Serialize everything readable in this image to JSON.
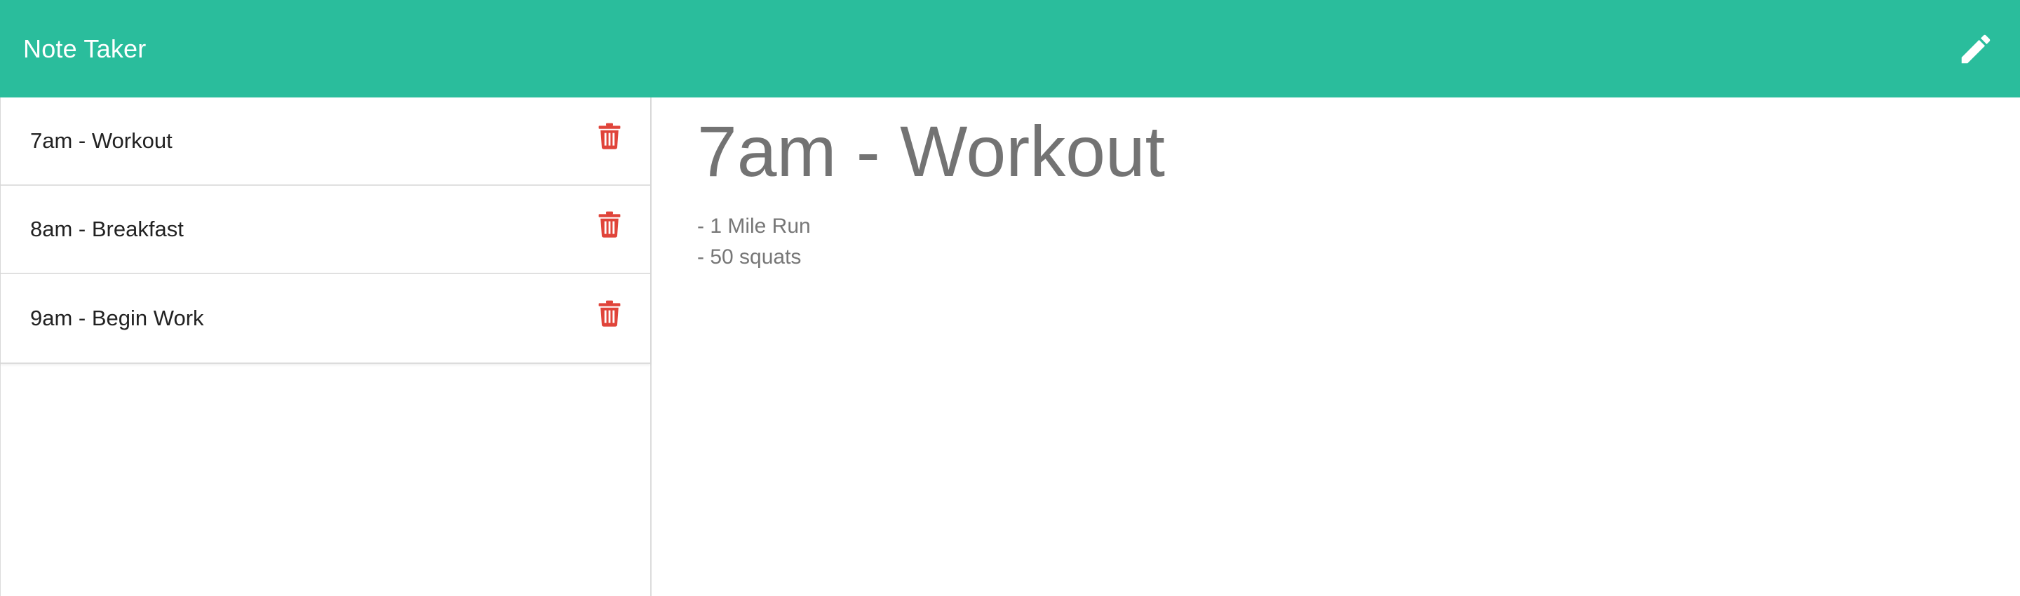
{
  "app": {
    "title": "Note Taker",
    "accent_color": "#2abd9c",
    "delete_color": "#e0443a"
  },
  "header": {
    "new_note_icon": "pencil-icon"
  },
  "sidebar": {
    "notes": [
      {
        "title": "7am - Workout",
        "delete_icon": "trash-icon"
      },
      {
        "title": "8am - Breakfast",
        "delete_icon": "trash-icon"
      },
      {
        "title": "9am - Begin Work",
        "delete_icon": "trash-icon"
      }
    ]
  },
  "main": {
    "active_note": {
      "title": "7am - Workout",
      "lines": [
        "- 1 Mile Run",
        "- 50 squats"
      ]
    }
  }
}
